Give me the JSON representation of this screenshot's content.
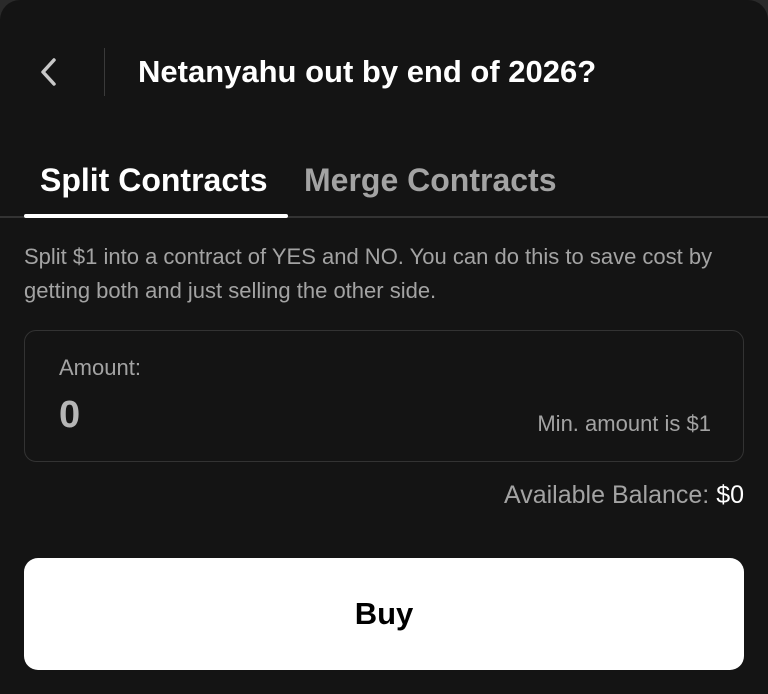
{
  "header": {
    "back_icon": "chevron-left-icon",
    "title": "Netanyahu out by end of 2026?"
  },
  "tabs": [
    {
      "label": "Split Contracts",
      "active": true
    },
    {
      "label": "Merge Contracts",
      "active": false
    }
  ],
  "description": "Split $1 into a contract of YES and NO. You can do this to save cost by getting both and just selling the other side.",
  "amount": {
    "label": "Amount:",
    "value": "0",
    "hint": "Min. amount is $1"
  },
  "balance": {
    "label": "Available Balance:",
    "value": "$0"
  },
  "buy_button": {
    "label": "Buy"
  },
  "colors": {
    "background": "#141414",
    "text_primary": "#ffffff",
    "text_secondary": "#a3a3a3",
    "border": "#333333",
    "button_bg": "#ffffff",
    "button_text": "#000000"
  }
}
